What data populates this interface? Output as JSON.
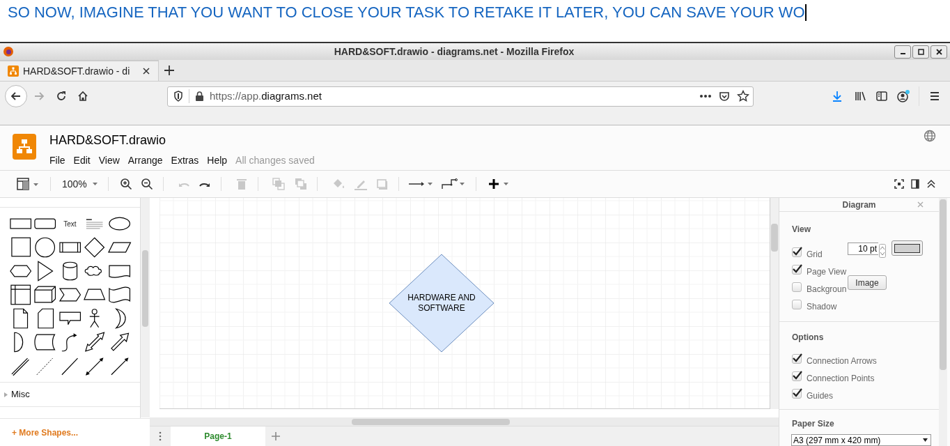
{
  "caption": {
    "text": "SO NOW, IMAGINE THAT YOU WANT TO CLOSE YOUR TASK TO RETAKE IT LATER, YOU CAN SAVE YOUR WO"
  },
  "window": {
    "title": "HARD&SOFT.drawio - diagrams.net - Mozilla Firefox"
  },
  "tabs": [
    {
      "label": "HARD&SOFT.drawio - di",
      "selected": true
    }
  ],
  "address": {
    "prefix": "https://app.",
    "domain": "diagrams.net"
  },
  "app": {
    "title": "HARD&SOFT.drawio",
    "menus": [
      "File",
      "Edit",
      "View",
      "Arrange",
      "Extras",
      "Help"
    ],
    "status": "All changes saved"
  },
  "toolbar": [
    {
      "kind": "layout",
      "disabled": false
    },
    {
      "kind": "zoom",
      "label": "100%",
      "disabled": false
    },
    {
      "kind": "zoom-in",
      "disabled": false
    },
    {
      "kind": "zoom-out",
      "disabled": false
    },
    {
      "kind": "undo",
      "disabled": true
    },
    {
      "kind": "redo",
      "disabled": false
    },
    {
      "kind": "delete",
      "disabled": true
    },
    {
      "kind": "to-front",
      "disabled": true
    },
    {
      "kind": "to-back",
      "disabled": true
    },
    {
      "kind": "fill",
      "disabled": true
    },
    {
      "kind": "line",
      "disabled": true
    },
    {
      "kind": "shadow",
      "disabled": true
    },
    {
      "kind": "connection",
      "disabled": false
    },
    {
      "kind": "waypoint",
      "disabled": false
    },
    {
      "kind": "insert",
      "disabled": false
    }
  ],
  "sidebar": {
    "text_shape": "Text",
    "sections": [
      {
        "label": "Misc",
        "expanded": false
      }
    ],
    "more": "+ More Shapes..."
  },
  "canvas": {
    "shape_label": "HARDWARE AND SOFTWARE"
  },
  "pages": [
    {
      "label": "Page-1",
      "selected": true
    }
  ],
  "panel": {
    "title": "Diagram",
    "view": {
      "heading": "View",
      "items": [
        {
          "kind": "grid",
          "label": "Grid",
          "checked": true,
          "value": "10 pt"
        },
        {
          "kind": "plain",
          "label": "Page View",
          "checked": true
        },
        {
          "kind": "background",
          "label": "Backgroun",
          "checked": false,
          "button": "Image"
        },
        {
          "kind": "plain",
          "label": "Shadow",
          "checked": false
        }
      ]
    },
    "options": {
      "heading": "Options",
      "items": [
        {
          "label": "Connection Arrows",
          "checked": true
        },
        {
          "label": "Connection Points",
          "checked": true
        },
        {
          "label": "Guides",
          "checked": true
        }
      ]
    },
    "paper": {
      "heading": "Paper Size",
      "value": "A3 (297 mm x 420 mm)"
    }
  }
}
